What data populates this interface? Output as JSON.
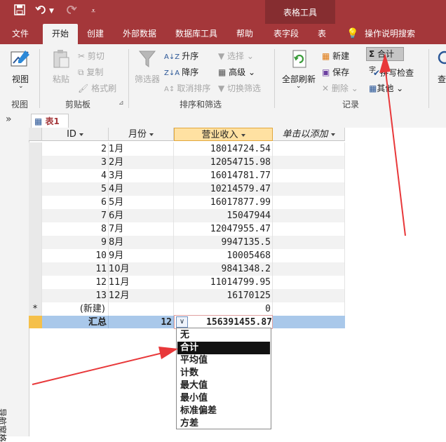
{
  "title_bar": {
    "context_tab": "表格工具"
  },
  "tabs": [
    "文件",
    "开始",
    "创建",
    "外部数据",
    "数据库工具",
    "帮助",
    "表字段",
    "表",
    "操作说明搜索"
  ],
  "ribbon": {
    "view": {
      "label": "视图",
      "group": "视图"
    },
    "clipboard": {
      "paste": "粘贴",
      "cut": "剪切",
      "copy": "复制",
      "format_painter": "格式刷",
      "group": "剪贴板"
    },
    "sort_filter": {
      "filter": "筛选器",
      "ascending": "升序",
      "descending": "降序",
      "remove_sort": "取消排序",
      "selection": "选择",
      "advanced": "高级",
      "toggle_filter": "切换筛选",
      "group": "排序和筛选"
    },
    "records": {
      "refresh_all": "全部刷新",
      "new": "新建",
      "save": "保存",
      "delete": "删除",
      "totals": "合计",
      "spelling": "拼写检查",
      "more": "其他",
      "partial": "字",
      "group": "记录"
    },
    "find_partial": "查"
  },
  "nav_pane": {
    "label": "导航窗格",
    "toggle": "»"
  },
  "table_tab": "表1",
  "columns": [
    "ID",
    "月份",
    "营业收入",
    "单击以添加"
  ],
  "rows": [
    {
      "id": "2",
      "month": "1月",
      "revenue": "18014724.54"
    },
    {
      "id": "3",
      "month": "2月",
      "revenue": "12054715.98"
    },
    {
      "id": "4",
      "month": "3月",
      "revenue": "16014781.77"
    },
    {
      "id": "5",
      "month": "4月",
      "revenue": "10214579.47"
    },
    {
      "id": "6",
      "month": "5月",
      "revenue": "16017877.99"
    },
    {
      "id": "7",
      "month": "6月",
      "revenue": "15047944"
    },
    {
      "id": "8",
      "month": "7月",
      "revenue": "12047955.47"
    },
    {
      "id": "9",
      "month": "8月",
      "revenue": "9947135.5"
    },
    {
      "id": "10",
      "month": "9月",
      "revenue": "10005468"
    },
    {
      "id": "11",
      "month": "10月",
      "revenue": "9841348.2"
    },
    {
      "id": "12",
      "month": "11月",
      "revenue": "11014799.95"
    },
    {
      "id": "13",
      "month": "12月",
      "revenue": "16170125"
    }
  ],
  "new_row": {
    "marker": "*",
    "label": "(新建)",
    "revenue": "0"
  },
  "totals_row": {
    "label": "汇总",
    "month_count": "12",
    "revenue_total": "156391455.87"
  },
  "dropdown_options": [
    "无",
    "合计",
    "平均值",
    "计数",
    "最大值",
    "最小值",
    "标准偏差",
    "方差"
  ],
  "dropdown_selected": "合计",
  "colors": {
    "accent": "#a4373a",
    "arrow": "#e8383a",
    "totals_row": "#a9c8ea"
  }
}
